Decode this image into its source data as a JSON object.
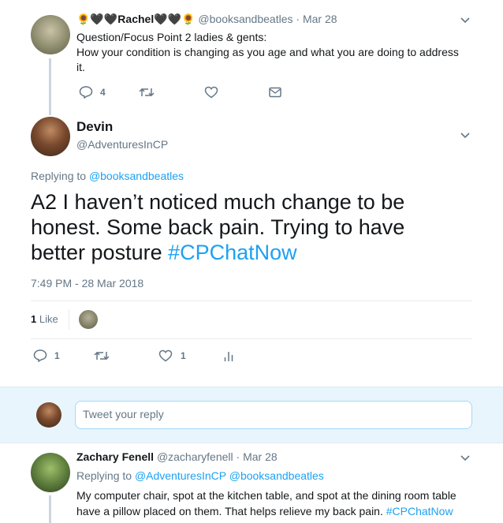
{
  "parent_tweet": {
    "name_prefix_emoji": "🌻🖤🖤",
    "name": "Rachel",
    "name_suffix_emoji": "🖤🖤🌻",
    "handle": "@booksandbeatles",
    "separator": "·",
    "date": "Mar 28",
    "text_line1": "Question/Focus Point 2 ladies & gents:",
    "text_line2": "How your condition is changing as you age and what you are doing to address",
    "text_line3": "it.",
    "reply_count": "4"
  },
  "main_tweet": {
    "name": "Devin",
    "handle": "@AdventuresInCP",
    "replying_prefix": "Replying to",
    "replying_to": "@booksandbeatles",
    "text_line1": "A2 I haven’t noticed much change to be",
    "text_line2": "honest. Some back pain. Trying to have",
    "text_line3_start": "better posture ",
    "hashtag": "#CPChatNow",
    "timestamp": "7:49 PM - 28 Mar 2018",
    "likes_count": "1",
    "likes_label": "Like",
    "reply_count": "1",
    "like_count": "1"
  },
  "reply_box": {
    "placeholder": "Tweet your reply"
  },
  "reply_tweet": {
    "name": "Zachary Fenell",
    "handle": "@zacharyfenell",
    "separator": "·",
    "date": "Mar 28",
    "replying_prefix": "Replying to",
    "replying_to1": "@AdventuresInCP",
    "replying_to2": "@booksandbeatles",
    "text_line1": "My computer chair, spot at the kitchen table, and spot at the dining room table",
    "text_line2_start": "have a pillow placed on them. That helps relieve my back pain. ",
    "hashtag": "#CPChatNow"
  },
  "colors": {
    "accent": "#1da1f2",
    "muted": "#657786",
    "thread_line": "#ccd6dd",
    "reply_bg": "#e8f5fd"
  },
  "icons": [
    "reply-icon",
    "retweet-icon",
    "heart-icon",
    "mail-icon",
    "chevron-down-icon",
    "analytics-icon"
  ]
}
